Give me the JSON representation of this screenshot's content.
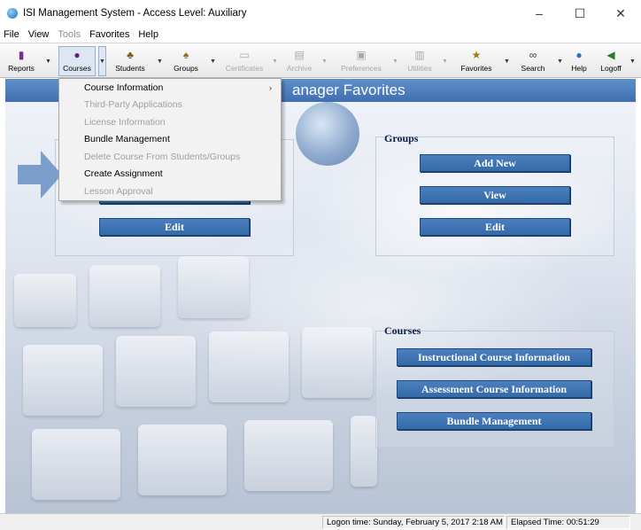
{
  "window": {
    "title": "ISI Management System - Access Level: Auxiliary",
    "minimize": "–",
    "maximize": "☐",
    "close": "✕"
  },
  "menubar": {
    "items": [
      {
        "label": "File",
        "disabled": false
      },
      {
        "label": "View",
        "disabled": false
      },
      {
        "label": "Tools",
        "disabled": true
      },
      {
        "label": "Favorites",
        "disabled": false
      },
      {
        "label": "Help",
        "disabled": false
      }
    ]
  },
  "toolbar": {
    "buttons": [
      {
        "label": "Reports",
        "icon": "reports-icon",
        "disabled": false
      },
      {
        "label": "Courses",
        "icon": "courses-icon",
        "disabled": false,
        "active": true
      },
      {
        "label": "Students",
        "icon": "students-icon",
        "disabled": false
      },
      {
        "label": "Groups",
        "icon": "groups-icon",
        "disabled": false
      },
      {
        "label": "Certificates",
        "icon": "certificates-icon",
        "disabled": true
      },
      {
        "label": "Archive",
        "icon": "archive-icon",
        "disabled": true
      },
      {
        "label": "Preferences",
        "icon": "preferences-icon",
        "disabled": true
      },
      {
        "label": "Utilities",
        "icon": "utilities-icon",
        "disabled": true
      },
      {
        "label": "Favorites",
        "icon": "favorites-icon",
        "disabled": false
      },
      {
        "label": "Search",
        "icon": "search-icon",
        "disabled": false
      },
      {
        "label": "Help",
        "icon": "help-icon",
        "disabled": false
      },
      {
        "label": "Logoff",
        "icon": "logoff-icon",
        "disabled": false
      }
    ],
    "dropdown_arrow": "▼"
  },
  "main": {
    "header_title": "anager Favorites",
    "groups_section": {
      "title": "Groups",
      "buttons": [
        "Add New",
        "View",
        "Edit"
      ]
    },
    "left_section": {
      "edit_label": "Edit"
    },
    "courses_section": {
      "title": "Courses",
      "buttons": [
        "Instructional Course Information",
        "Assessment Course Information",
        "Bundle Management"
      ]
    }
  },
  "courses_menu": {
    "items": [
      {
        "label": "Course Information",
        "disabled": false,
        "submenu": true
      },
      {
        "label": "Third-Party Applications",
        "disabled": true
      },
      {
        "label": "License Information",
        "disabled": true
      },
      {
        "label": "Bundle Management",
        "disabled": false
      },
      {
        "label": "Delete Course From Students/Groups",
        "disabled": true
      },
      {
        "label": "Create Assignment",
        "disabled": false
      },
      {
        "label": "Lesson Approval",
        "disabled": true
      }
    ],
    "submenu_arrow": "›"
  },
  "statusbar": {
    "logon": "Logon time: Sunday, February 5, 2017 2:18 AM",
    "elapsed": "Elapsed Time: 00:51:29"
  },
  "colors": {
    "header_band": "#4a7cbf",
    "button_blue": "#3f72b0",
    "arrow": "#6f95c7"
  }
}
